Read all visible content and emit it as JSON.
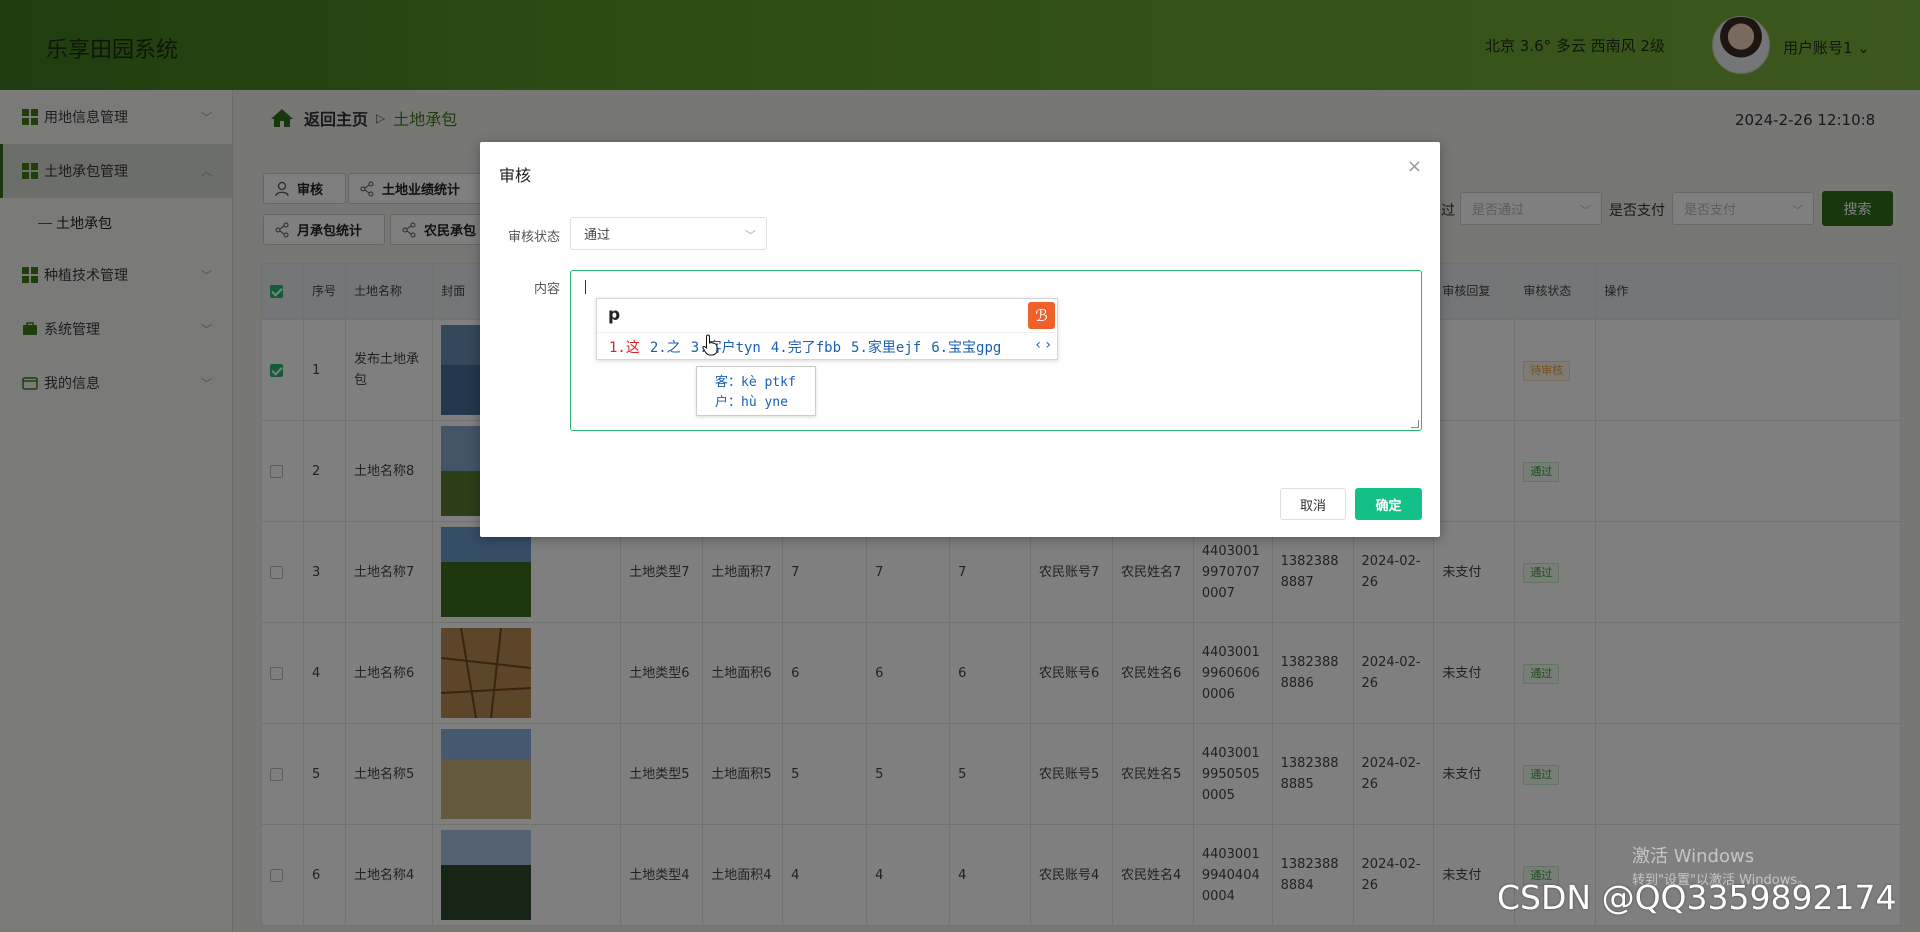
{
  "app": {
    "title": "乐享田园系统"
  },
  "header": {
    "weather": "北京  3.6°  多云  西南风  2级",
    "user": "用户账号1 ⌄"
  },
  "sidebar": {
    "items": [
      {
        "label": "用地信息管理",
        "icon": "grid-icon"
      },
      {
        "label": "土地承包管理",
        "icon": "grid-icon",
        "active": true
      },
      {
        "label": "土地承包",
        "sub": true
      },
      {
        "label": "种植技术管理",
        "icon": "grid-icon"
      },
      {
        "label": "系统管理",
        "icon": "briefcase-icon"
      },
      {
        "label": "我的信息",
        "icon": "wallet-icon"
      }
    ]
  },
  "breadcrumb": {
    "home": "返回主页",
    "separator": "▷",
    "current": "土地承包"
  },
  "datetime": "2024-2-26 12:10:8",
  "toolbar": {
    "audit": "审核",
    "land_stats": "土地业绩统计",
    "month_stats": "月承包统计",
    "farmer": "农民承包"
  },
  "filters": {
    "audit_partial_label": "过",
    "audit_placeholder": "是否通过",
    "paid_label": "是否支付",
    "paid_placeholder": "是否支付",
    "search": "搜索"
  },
  "table": {
    "headers": [
      "序号",
      "土地名称",
      "封面",
      "审核回复",
      "审核状态",
      "操作"
    ],
    "rows": [
      {
        "no": "1",
        "name": "发布土地承包",
        "cells": [],
        "status": "待审核"
      },
      {
        "no": "2",
        "name": "土地名称8",
        "cells": [],
        "status": "通过"
      },
      {
        "no": "3",
        "name": "土地名称7",
        "type": "土地类型7",
        "area": "土地面积7",
        "a": "7",
        "b": "7",
        "c": "7",
        "account": "农民账号7",
        "farmer": "农民姓名7",
        "id": "440300199707070007",
        "phone": "13823888887",
        "date": "2024-02-26",
        "pay": "未支付",
        "status": "通过"
      },
      {
        "no": "4",
        "name": "土地名称6",
        "type": "土地类型6",
        "area": "土地面积6",
        "a": "6",
        "b": "6",
        "c": "6",
        "account": "农民账号6",
        "farmer": "农民姓名6",
        "id": "440300199606060006",
        "phone": "13823888886",
        "date": "2024-02-26",
        "pay": "未支付",
        "status": "通过"
      },
      {
        "no": "5",
        "name": "土地名称5",
        "type": "土地类型5",
        "area": "土地面积5",
        "a": "5",
        "b": "5",
        "c": "5",
        "account": "农民账号5",
        "farmer": "农民姓名5",
        "id": "440300199505050005",
        "phone": "13823888885",
        "date": "2024-02-26",
        "pay": "未支付",
        "status": "通过"
      },
      {
        "no": "6",
        "name": "土地名称4",
        "type": "土地类型4",
        "area": "土地面积4",
        "a": "4",
        "b": "4",
        "c": "4",
        "account": "农民账号4",
        "farmer": "农民姓名4",
        "id": "440300199404040004",
        "phone": "13823888884",
        "date": "2024-02-26",
        "pay": "未支付",
        "status": "通过"
      }
    ]
  },
  "modal": {
    "title": "审核",
    "close": "×",
    "status_label": "审核状态",
    "status_value": "通过",
    "content_label": "内容",
    "cancel": "取消",
    "confirm": "确定"
  },
  "ime": {
    "input": "p",
    "logo": "ℬ",
    "candidates": [
      "1.这",
      "2.之",
      "3.客户tyn",
      "4.完了fbb",
      "5.家里ejf",
      "6.宝宝gpg"
    ],
    "nav": "‹ ›",
    "tip_line1": "客：kè  ptkf",
    "tip_line2": "户：hù  yne"
  },
  "watermarks": {
    "windows_line1": "激活 Windows",
    "windows_line2": "转到\"设置\"以激活 Windows。",
    "csdn": "CSDN @QQ3359892174"
  },
  "colors": {
    "brand_green": "#3f7a1f",
    "confirm": "#13c088",
    "search": "#2f6f1a"
  }
}
